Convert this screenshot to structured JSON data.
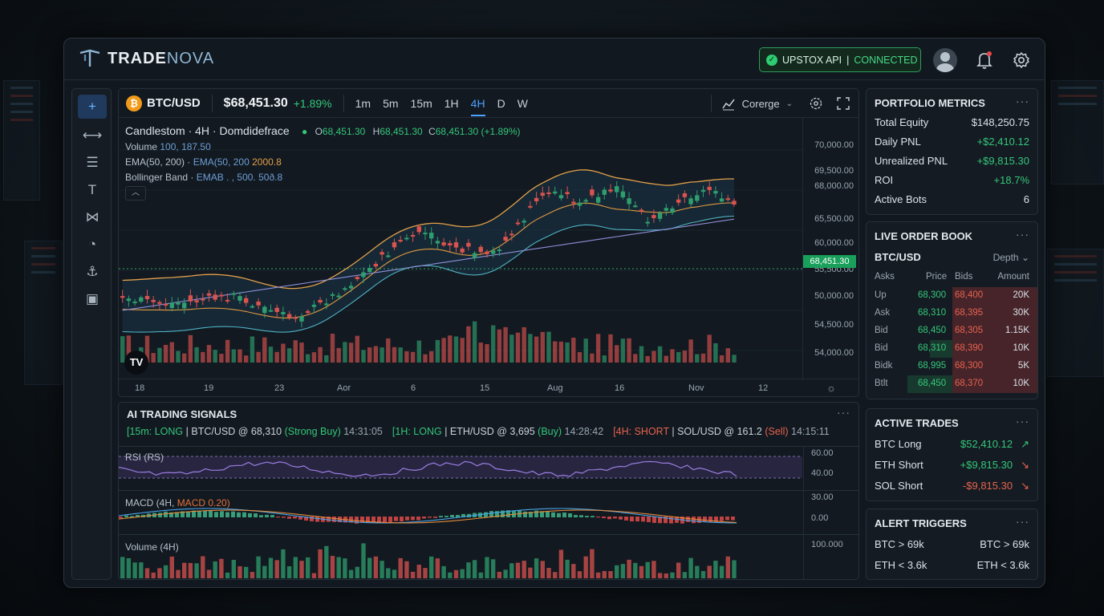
{
  "app": {
    "brand_a": "TRADE",
    "brand_b": "NOVA"
  },
  "connection": {
    "label": "UPSTOX API",
    "sep": "|",
    "status": "CONNECTED"
  },
  "header": {
    "pair": "BTC/USD",
    "coin_symbol": "₿",
    "price": "$68,451.30",
    "change": "+1.89%",
    "timeframes": [
      "1m",
      "5m",
      "15m",
      "1H",
      "4H",
      "D",
      "W"
    ],
    "active_timeframe": "4H",
    "chart_type": "Corerge"
  },
  "legend": {
    "title": "Candlestom · 4H · Domdidefrace",
    "ohlc_o": "O",
    "ohlc_o_val": "68,451.30",
    "ohlc_h": "H",
    "ohlc_h_val": "68,451.30",
    "ohlc_c": "C",
    "ohlc_c_val": "68,451.30 (+1.89%)",
    "volume_label": "Volume",
    "volume_val": "100, 187.50",
    "ema_label": "EMA(50, 200)",
    "ema_val1": "EMA(50, 200",
    "ema_val2": "2000.8",
    "bb_label": "Bollinger Band",
    "bb_val": "EMAB . , 500. 50ð.8"
  },
  "chart": {
    "y_ticks": [
      "70,000.00",
      "69,500.00",
      "68,000.00",
      "65,500.00",
      "60,000.00",
      "55,500.00",
      "50,000.00",
      "54,500.00",
      "54,000.00"
    ],
    "price_tag": "68,451.30",
    "x_ticks": [
      "18",
      "19",
      "23",
      "Aor",
      "6",
      "15",
      "Aug",
      "16",
      "Nov",
      "12"
    ],
    "tv_logo": "TV"
  },
  "signals": {
    "title": "AI TRADING SIGNALS",
    "items": [
      {
        "tag": "[15m: LONG",
        "text": " | BTC/USD @ 68,310 ",
        "action": "(Strong Buy)",
        "time": " 14:31:05",
        "color": "green"
      },
      {
        "tag": "[1H: LONG",
        "text": " | ETH/USD @ 3,695 ",
        "action": "(Buy)",
        "time": " 14:28:42",
        "color": "green"
      },
      {
        "tag": "[4H: SHORT",
        "text": " | SOL/USD @ 161.2 ",
        "action": "(Sell)",
        "time": " 14:15:11",
        "color": "red"
      }
    ]
  },
  "rsi": {
    "label": "RSI (RS)",
    "ticks": [
      "60.00",
      "40.00"
    ]
  },
  "macd": {
    "label": "MACD (4H,",
    "value": "MACD 0.20)",
    "ticks": [
      "30.00",
      "0.00"
    ]
  },
  "volume4h": {
    "label": "Volume (4H)",
    "ticks": [
      "100.000"
    ]
  },
  "portfolio": {
    "title": "PORTFOLIO METRICS",
    "rows": [
      {
        "label": "Total Equity",
        "value": "$148,250.75",
        "tone": "neutral"
      },
      {
        "label": "Daily PNL",
        "value": "+$2,410.12",
        "tone": "green"
      },
      {
        "label": "Unrealized PNL",
        "value": "+$9,815.30",
        "tone": "green"
      },
      {
        "label": "ROI",
        "value": "+18.7%",
        "tone": "green"
      },
      {
        "label": "Active Bots",
        "value": "6",
        "tone": "neutral"
      }
    ]
  },
  "orderbook": {
    "title": "LIVE ORDER BOOK",
    "pair": "BTC/USD",
    "mode": "Depth",
    "headers": [
      "Asks",
      "Price",
      "Bids",
      "Amount"
    ],
    "rows": [
      {
        "label": "Up",
        "price": "68,300",
        "bid": "68,400",
        "amount": "20K",
        "ask_fill": 0
      },
      {
        "label": "Ask",
        "price": "68,310",
        "bid": "68,395",
        "amount": "30K",
        "ask_fill": 0
      },
      {
        "label": "Bid",
        "price": "68,450",
        "bid": "68,305",
        "amount": "1.15K",
        "ask_fill": 0
      },
      {
        "label": "Bid",
        "price": "68,310",
        "bid": "68,390",
        "amount": "10K",
        "ask_fill": 0.5
      },
      {
        "label": "Bidk",
        "price": "68,995",
        "bid": "68,300",
        "amount": "5K",
        "ask_fill": 0
      },
      {
        "label": "Btlt",
        "price": "68,450",
        "bid": "68,370",
        "amount": "10K",
        "ask_fill": 1
      }
    ]
  },
  "active_trades": {
    "title": "ACTIVE TRADES",
    "rows": [
      {
        "label": "BTC Long",
        "value": "$52,410.12",
        "arrow": "↗",
        "tone": "green"
      },
      {
        "label": "ETH Short",
        "value": "+$9,815.30",
        "arrow": "↘",
        "tone": "green"
      },
      {
        "label": "SOL Short",
        "value": "-$9,815.30",
        "arrow": "↘",
        "tone": "red"
      }
    ]
  },
  "alerts": {
    "title": "ALERT TRIGGERS",
    "rows": [
      {
        "left": "BTC > 69k",
        "right": "BTC > 69k"
      },
      {
        "left": "ETH < 3.6k",
        "right": "ETH < 3.6k"
      }
    ]
  },
  "colors": {
    "up": "#2f9e6e",
    "down": "#d9534f",
    "accent": "#4da3ff",
    "bb": "#e3a04a",
    "ema": "#4fb3c4"
  }
}
